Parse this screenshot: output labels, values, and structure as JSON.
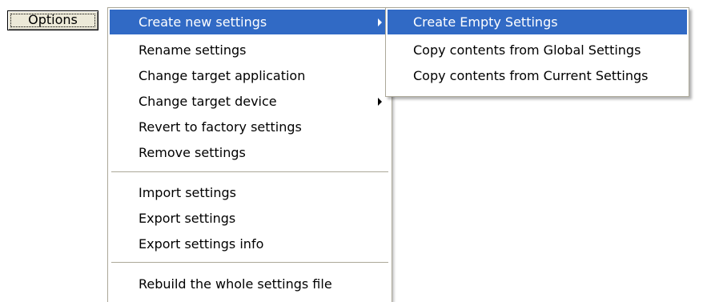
{
  "options_button": {
    "label": "Options"
  },
  "menu": {
    "items": [
      {
        "label": "Create new settings",
        "highlighted": true,
        "has_submenu": true
      },
      {
        "label": "Rename settings"
      },
      {
        "label": "Change target application"
      },
      {
        "label": "Change target device",
        "has_submenu": true
      },
      {
        "label": "Revert to factory settings"
      },
      {
        "label": "Remove settings"
      },
      {
        "label": "Import settings"
      },
      {
        "label": "Export settings"
      },
      {
        "label": "Export settings info"
      },
      {
        "label": "Rebuild the whole settings file"
      }
    ]
  },
  "submenu": {
    "items": [
      {
        "label": "Create Empty Settings",
        "highlighted": true
      },
      {
        "label": "Copy contents from Global Settings"
      },
      {
        "label": "Copy contents from Current Settings"
      }
    ]
  },
  "colors": {
    "highlight": "#316ac5",
    "highlight_text": "#ffffff",
    "separator": "#aca899",
    "button_face": "#ece9d8"
  }
}
